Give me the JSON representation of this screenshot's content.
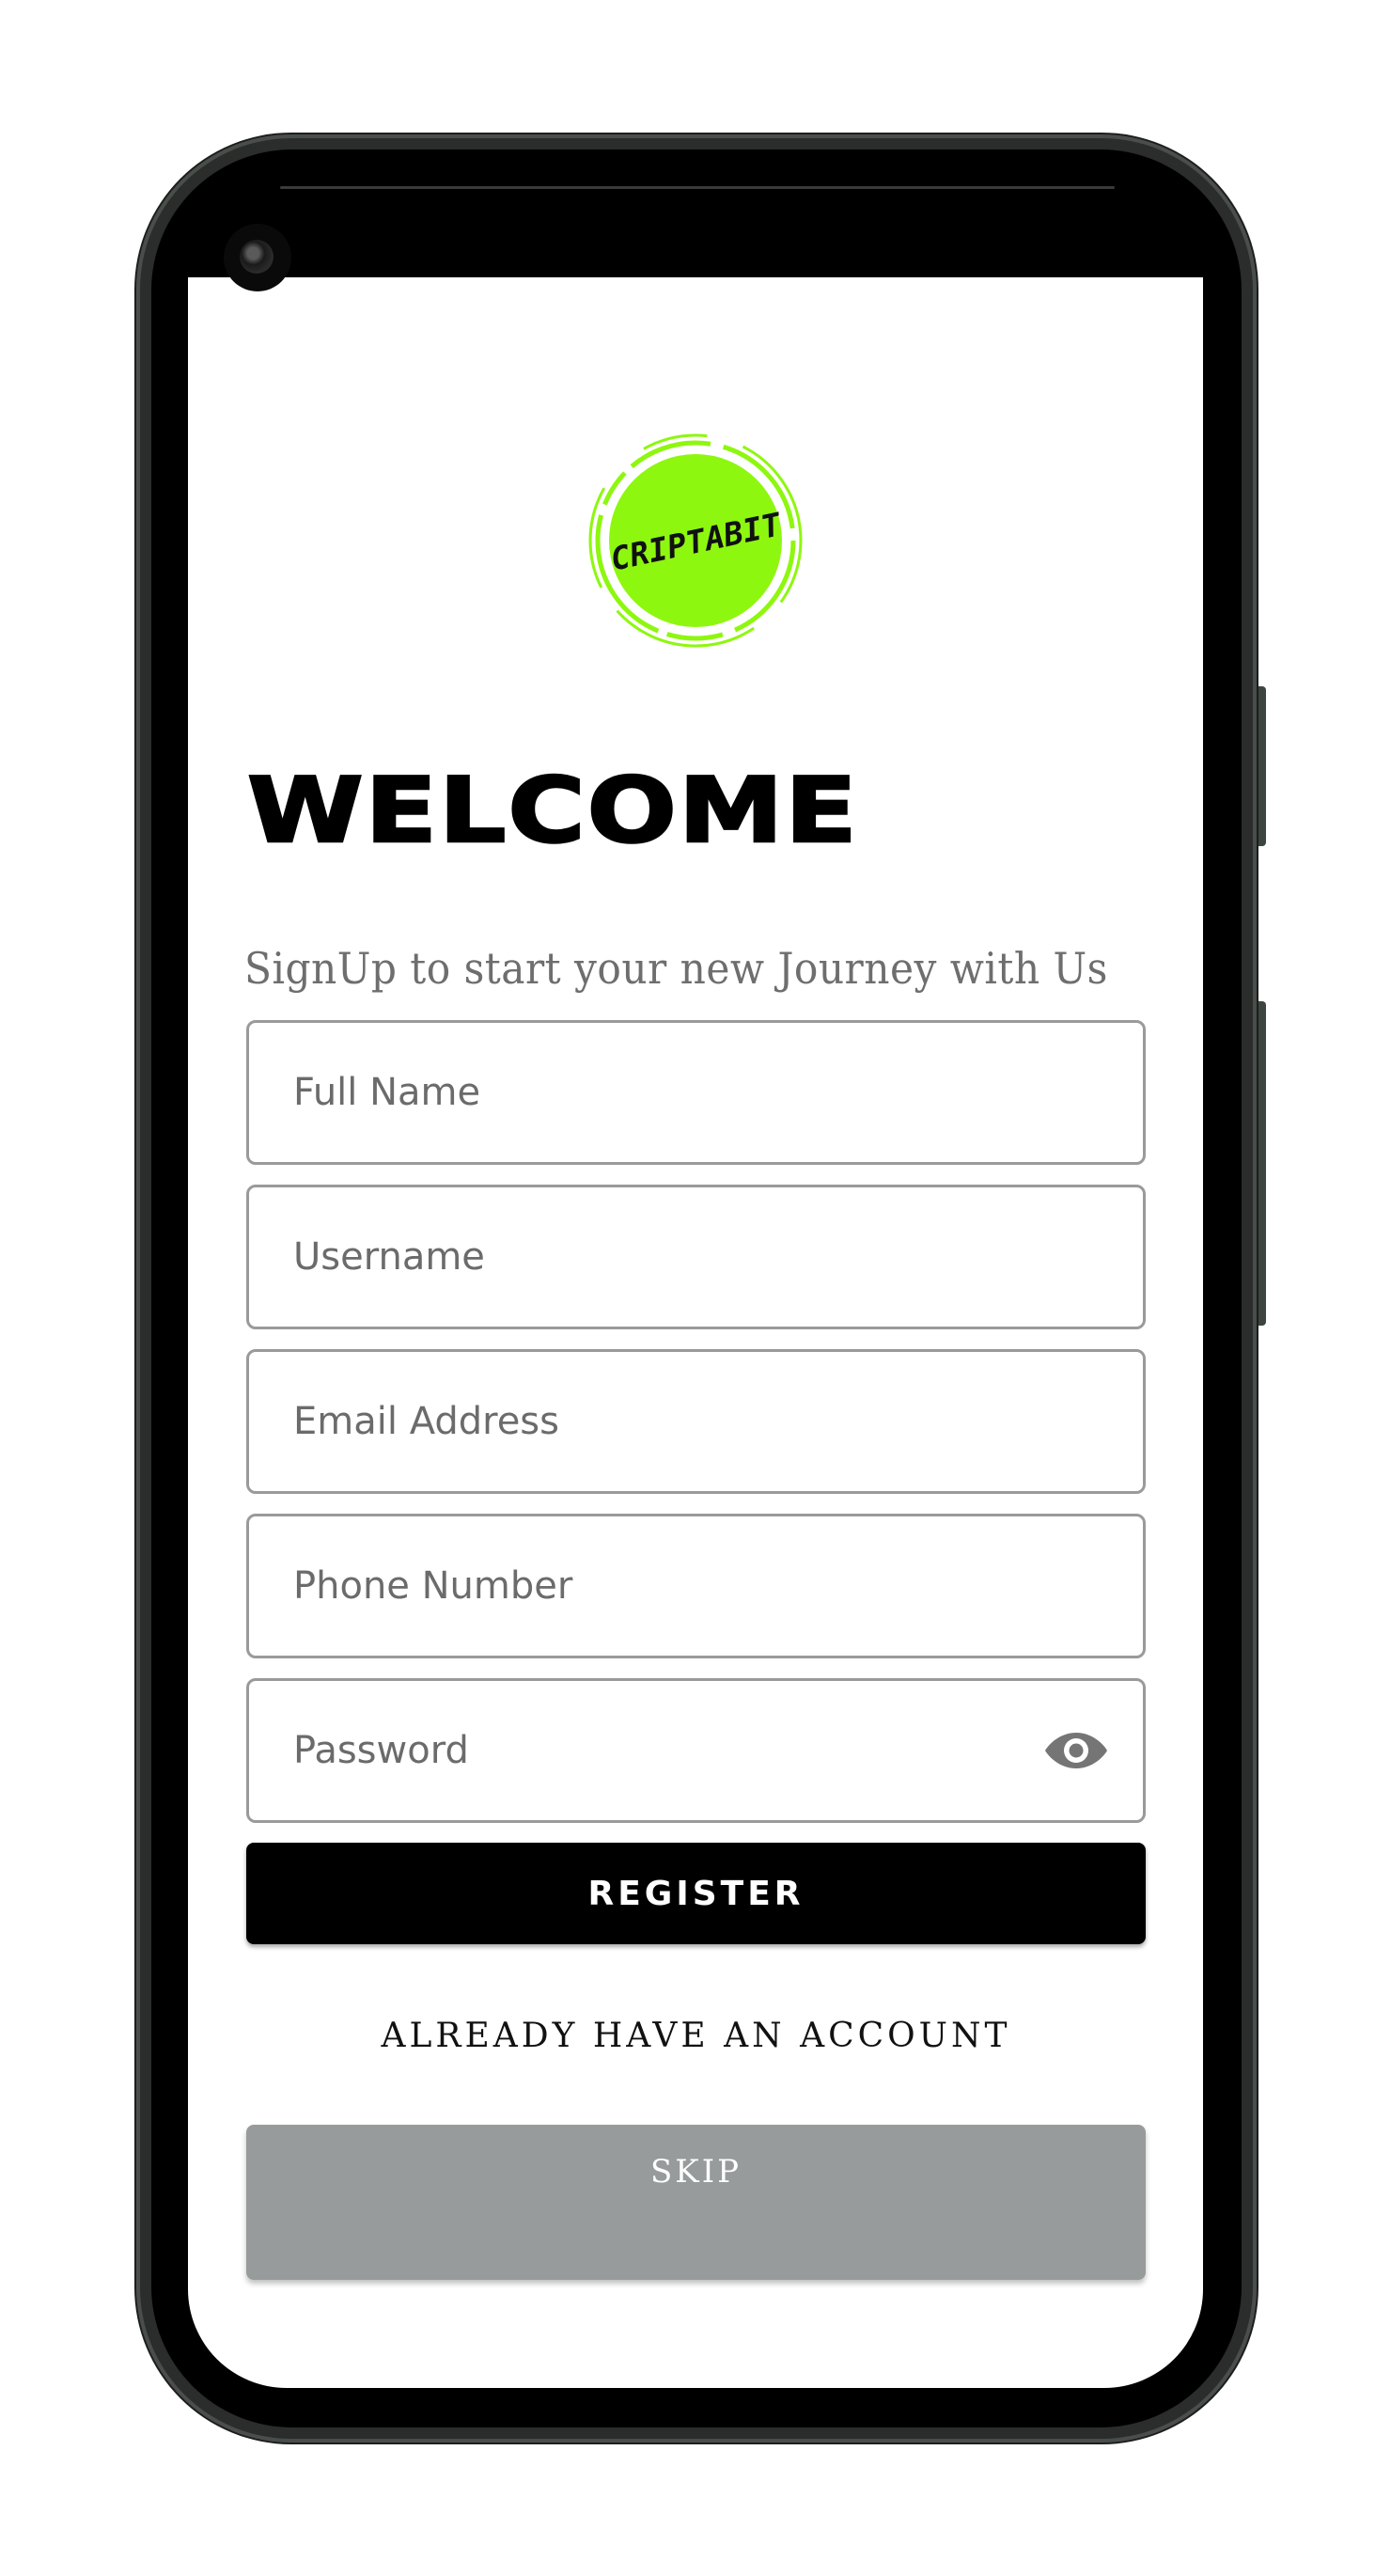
{
  "app": {
    "logo_text": "CRIPTABIT",
    "brand_color": "#8ef70f"
  },
  "header": {
    "title": "WELCOME",
    "subtitle": "SignUp to start your new Journey with Us"
  },
  "form": {
    "full_name_placeholder": "Full Name",
    "username_placeholder": "Username",
    "email_placeholder": "Email Address",
    "phone_placeholder": "Phone Number",
    "password_placeholder": "Password",
    "password_toggle_icon": "eye-icon"
  },
  "actions": {
    "register_label": "REGISTER",
    "login_link_label": "ALREADY HAVE AN ACCOUNT",
    "skip_label": "SKIP"
  },
  "colors": {
    "primary_button": "#000000",
    "skip_button": "#989b9b",
    "field_border": "#9a9a9a"
  }
}
